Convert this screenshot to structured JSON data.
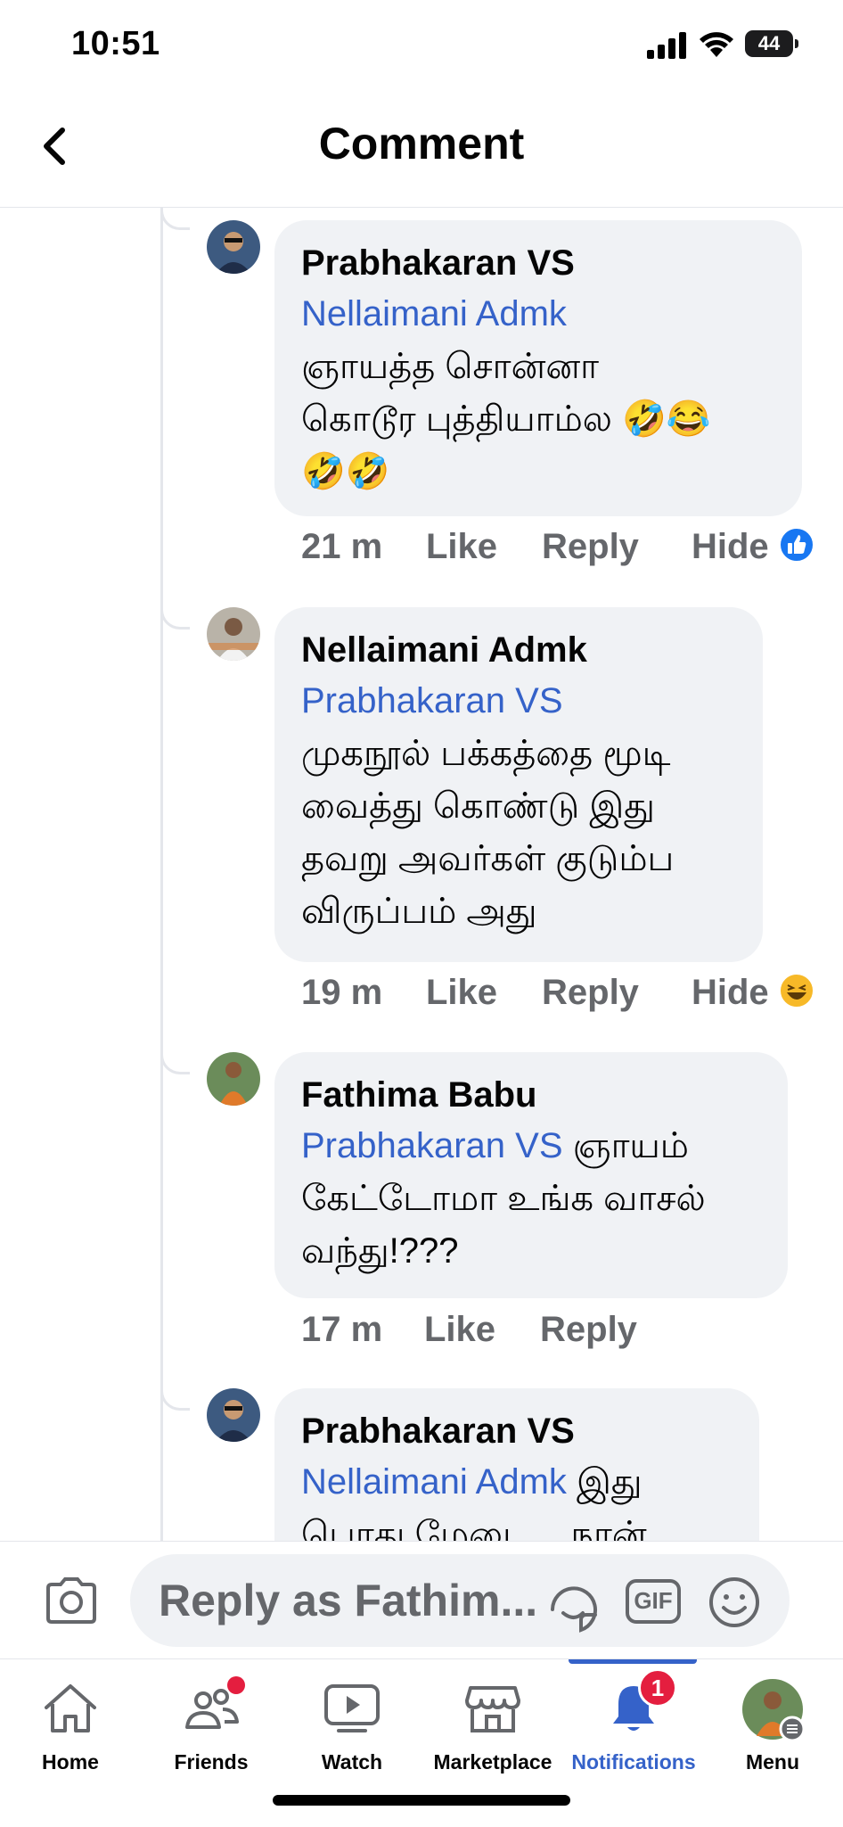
{
  "status_bar": {
    "time": "10:51",
    "battery": "44"
  },
  "header": {
    "title": "Comment"
  },
  "comments": [
    {
      "author": "Prabhakaran VS",
      "mention": "Nellaimani Admk",
      "text_lines": [
        "ஞாயத்த சொன்னா",
        "கொடூர புத்தியாம்ல 🤣😂",
        "🤣🤣"
      ],
      "time": "21 m",
      "like": "Like",
      "reply": "Reply",
      "hide": "Hide",
      "reaction": "like",
      "reaction_color": "#1877f2"
    },
    {
      "author": "Nellaimani Admk",
      "mention": "Prabhakaran VS",
      "text_lines": [
        "முகநூல் பக்கத்தை மூடி",
        "வைத்து கொண்டு இது",
        "தவறு அவர்கள் குடும்ப",
        "விருப்பம் அது"
      ],
      "time": "19 m",
      "like": "Like",
      "reply": "Reply",
      "hide": "Hide",
      "reaction": "haha",
      "reaction_color": "#f7b928"
    },
    {
      "author": "Fathima Babu",
      "mention": "Prabhakaran VS",
      "inline_text": "ஞாயம்",
      "text_lines": [
        "கேட்டோமா உங்க வாசல்",
        "வந்து!???"
      ],
      "time": "17 m",
      "like": "Like",
      "reply": "Reply"
    },
    {
      "author": "Prabhakaran VS",
      "mention": "Nellaimani Admk",
      "inline_text": "இது",
      "text_lines": [
        "பொது மேடை... நான்"
      ]
    }
  ],
  "composer": {
    "placeholder": "Reply as Fathim...",
    "gif_label": "GIF"
  },
  "tabs": [
    {
      "label": "Home"
    },
    {
      "label": "Friends",
      "dot": true
    },
    {
      "label": "Watch"
    },
    {
      "label": "Marketplace"
    },
    {
      "label": "Notifications",
      "badge": "1",
      "active": true
    },
    {
      "label": "Menu"
    }
  ],
  "colors": {
    "accent": "#3562c9",
    "bubble": "#f0f2f5",
    "meta": "#65676b",
    "badge": "#e41e3f"
  }
}
